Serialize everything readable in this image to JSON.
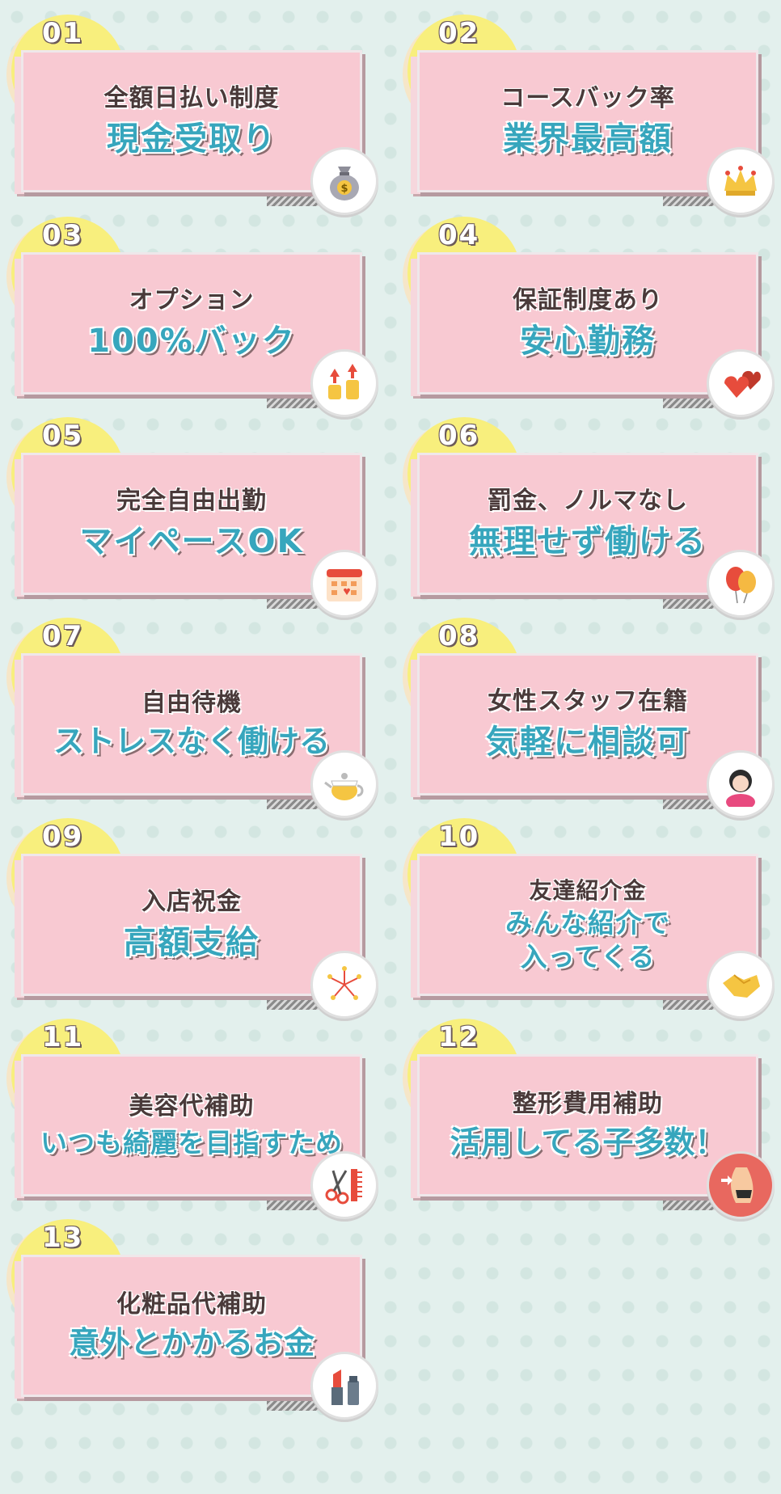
{
  "cards": [
    {
      "number": "01",
      "line1": "全額日払い制度",
      "line2": "現金受取り",
      "icon": "money-bag-icon"
    },
    {
      "number": "02",
      "line1": "コースバック率",
      "line2": "業界最高額",
      "icon": "crown-icon"
    },
    {
      "number": "03",
      "line1": "オプション",
      "line2": "100%バック",
      "icon": "coins-up-icon"
    },
    {
      "number": "04",
      "line1": "保証制度あり",
      "line2": "安心勤務",
      "icon": "hearts-icon"
    },
    {
      "number": "05",
      "line1": "完全自由出勤",
      "line2": "マイペースOK",
      "icon": "calendar-icon"
    },
    {
      "number": "06",
      "line1": "罰金、ノルマなし",
      "line2": "無理せず働ける",
      "icon": "balloons-icon"
    },
    {
      "number": "07",
      "line1": "自由待機",
      "line2": "ストレスなく働ける",
      "icon": "teapot-icon"
    },
    {
      "number": "08",
      "line1": "女性スタッフ在籍",
      "line2": "気軽に相談可",
      "icon": "woman-icon"
    },
    {
      "number": "09",
      "line1": "入店祝金",
      "line2": "高額支給",
      "icon": "fireworks-icon"
    },
    {
      "number": "10",
      "line1": "友達紹介金",
      "line2a": "みんな紹介で",
      "line2b": "入ってくる",
      "icon": "handshake-icon"
    },
    {
      "number": "11",
      "line1": "美容代補助",
      "line2": "いつも綺麗を目指すため",
      "icon": "scissors-comb-icon"
    },
    {
      "number": "12",
      "line1": "整形費用補助",
      "line2": "活用してる子多数！",
      "icon": "body-icon"
    },
    {
      "number": "13",
      "line1": "化粧品代補助",
      "line2": "意外とかかるお金",
      "icon": "cosmetics-icon"
    }
  ],
  "colors": {
    "background": "#e3f0ed",
    "tab": "#f8ef7d",
    "card": "#f8c9d2",
    "heading_text": "#4a3a3a",
    "accent_text": "#37a6bd"
  }
}
